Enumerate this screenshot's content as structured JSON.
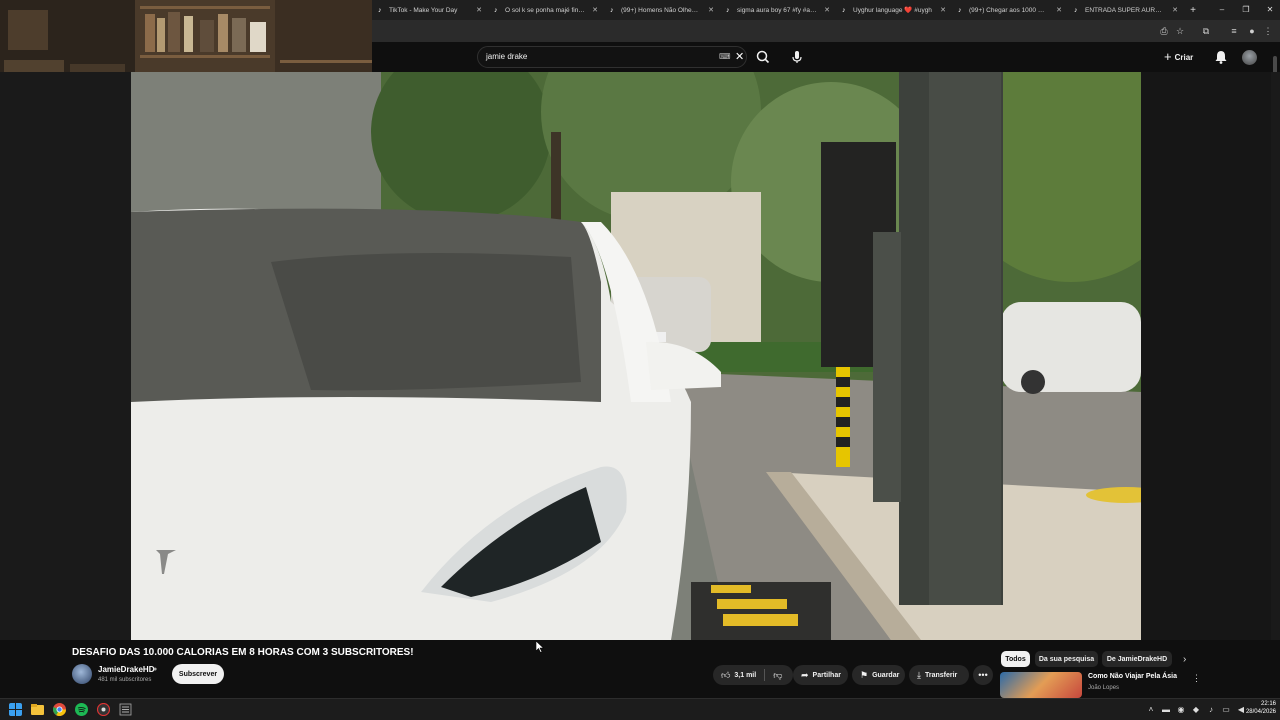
{
  "browser": {
    "tabs": [
      {
        "title": "TikTok - Make Your Day",
        "icon": "tiktok-icon"
      },
      {
        "title": "O sol k se ponha majé finu se",
        "icon": "tiktok-icon"
      },
      {
        "title": "(99+) Homens Não Olhem Pa",
        "icon": "tiktok-icon"
      },
      {
        "title": "sigma aura boy 67 #fy #aura",
        "icon": "tiktok-icon"
      },
      {
        "title": "Uyghur language ❤️ #uygh",
        "icon": "tiktok-icon"
      },
      {
        "title": "(99+) Chegar aos 1000 Golos",
        "icon": "tiktok-icon"
      },
      {
        "title": "ENTRADA SUPER AURA NA S",
        "icon": "tiktok-icon"
      }
    ],
    "new_tab": "+",
    "window_controls": [
      "–",
      "❐",
      "✕"
    ]
  },
  "masthead": {
    "search_value": "jamie drake",
    "create_label": "Criar"
  },
  "video": {
    "title": "DESAFIO DAS 10.000 CALORIAS EM 8 HORAS COM 3 SUBSCRITORES!",
    "channel": "JamieDrakeHD",
    "subscribers": "481 mil subscritores",
    "subscribe_label": "Subscrever",
    "likes": "3,1 mil",
    "share_label": "Partilhar",
    "save_label": "Guardar",
    "download_label": "Transferir"
  },
  "chips": [
    "Todos",
    "Da sua pesquisa",
    "De JamieDrakeHD"
  ],
  "suggestion": {
    "title": "Como Não Viajar Pela Ásia",
    "channel": "João Lopes"
  },
  "taskbar": {
    "time": "22:16",
    "date": "28/04/2026"
  },
  "colors": {
    "yt_background": "#0f0f0f",
    "chip_selected": "#f1f1f1",
    "pill_bg": "#272727",
    "tiktok_red": "#fe2c55",
    "tiktok_cyan": "#25f4ee"
  }
}
